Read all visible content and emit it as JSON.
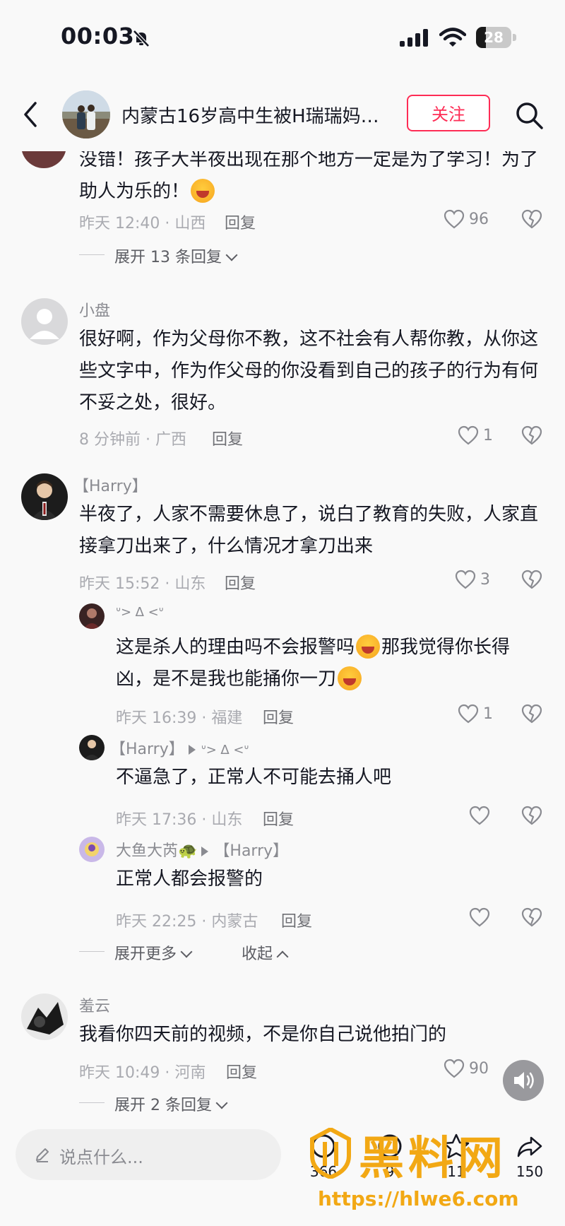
{
  "status_bar": {
    "time": "00:03",
    "battery": "28",
    "battery_level": 0.28
  },
  "header": {
    "title": "内蒙古16岁高中生被H瑞瑞妈…",
    "follow_label": "关注"
  },
  "comments": [
    {
      "text": "没错！孩子大半夜出现在那个地方一定是为了学习！为了助人为乐的！",
      "time_loc": "昨天 12:40 · 山西",
      "reply_label": "回复",
      "likes": "96",
      "expand_label": "展开 13 条回复"
    },
    {
      "name": "小盘",
      "text": "很好啊，作为父母你不教，这不社会有人帮你教，从你这些文字中，作为作父母的你没看到自己的孩子的行为有何不妥之处，很好。",
      "time_loc": "8 分钟前 · 广西",
      "reply_label": "回复",
      "likes": "1"
    },
    {
      "name": "【Harry】",
      "text": "半夜了，人家不需要休息了，说白了教育的失败，人家直接拿刀出来了，什么情况才拿刀出来",
      "time_loc": "昨天 15:52 · 山东",
      "reply_label": "回复",
      "likes": "3",
      "replies": [
        {
          "name": "ᐡ> ∆ <ᐡ",
          "text_a": "这是杀人的理由吗不会报警吗",
          "text_b": "那我觉得你长得凶，是不是我也能捅你一刀",
          "time_loc": "昨天 16:39 · 福建",
          "reply_label": "回复",
          "likes": "1"
        },
        {
          "name": "【Harry】",
          "reply_to": "ᐡ> ∆ <ᐡ",
          "text": "不逼急了，正常人不可能去捅人吧",
          "time_loc": "昨天 17:36 · 山东",
          "reply_label": "回复"
        },
        {
          "name": "大鱼大芮🐢",
          "reply_to": "【Harry】",
          "text": "正常人都会报警的",
          "time_loc": "昨天 22:25 · 内蒙古",
          "reply_label": "回复"
        }
      ],
      "expand_more_label": "展开更多",
      "collapse_label": "收起"
    },
    {
      "name": "羞云",
      "text": "我看你四天前的视频，不是你自己说他拍门的",
      "time_loc": "昨天 10:49 · 河南",
      "reply_label": "回复",
      "likes": "90",
      "expand_label": "展开 2 条回复"
    }
  ],
  "bottom_bar": {
    "input_placeholder": "说点什么...",
    "counts": [
      "366",
      "9",
      "11",
      "150"
    ]
  },
  "watermark": {
    "text": "黑料网",
    "url": "https://hlwe6.com"
  },
  "icons": [
    "back-icon",
    "search-icon",
    "heart-icon",
    "broken-heart-icon",
    "pencil-icon",
    "speaker-icon",
    "bell-slash-icon",
    "signal-icon",
    "wifi-icon"
  ],
  "colors": {
    "accent": "#fe2c55",
    "watermark": "#f2a814"
  }
}
